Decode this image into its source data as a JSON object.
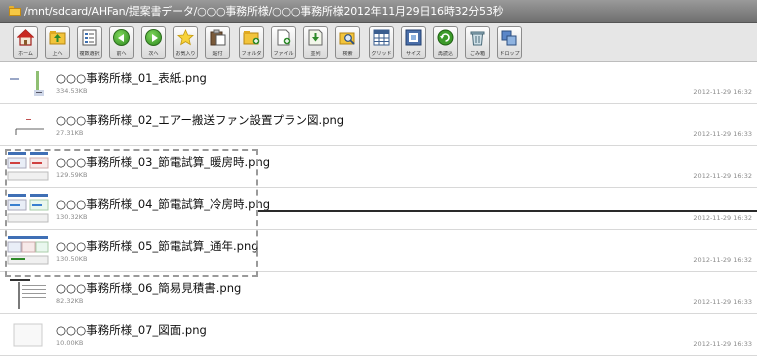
{
  "path": "/mnt/sdcard/AHFan/提案書データ/○○○事務所様/○○○事務所様2012年11月29日16時32分53秒",
  "toolbar": {
    "buttons": [
      {
        "label": "ホーム",
        "icon": "home-icon"
      },
      {
        "label": "上へ",
        "icon": "folder-up-icon"
      },
      {
        "label": "複数選択",
        "icon": "multi-select-icon"
      },
      {
        "label": "前へ",
        "icon": "back-arrow-icon"
      },
      {
        "label": "次へ",
        "icon": "forward-arrow-icon"
      },
      {
        "label": "お気入り",
        "icon": "star-icon"
      },
      {
        "label": "貼付",
        "icon": "paste-icon"
      },
      {
        "label": "フォルダ",
        "icon": "new-folder-icon"
      },
      {
        "label": "ファイル",
        "icon": "new-file-icon"
      },
      {
        "label": "並列",
        "icon": "sort-icon"
      },
      {
        "label": "検索",
        "icon": "search-icon"
      },
      {
        "label": "グリッド",
        "icon": "grid-icon"
      },
      {
        "label": "サイズ",
        "icon": "size-icon"
      },
      {
        "label": "再読込",
        "icon": "refresh-icon"
      },
      {
        "label": "ごみ箱",
        "icon": "trash-icon"
      },
      {
        "label": "ドロップ",
        "icon": "drop-icon"
      }
    ]
  },
  "files": [
    {
      "name": "○○○事務所様_01_表紙.png",
      "size": "334.53KB",
      "date": "2012-11-29 16:32"
    },
    {
      "name": "○○○事務所様_02_エアー搬送ファン設置プラン図.png",
      "size": "27.31KB",
      "date": "2012-11-29 16:33"
    },
    {
      "name": "○○○事務所様_03_節電試算_暖房時.png",
      "size": "129.59KB",
      "date": "2012-11-29 16:32"
    },
    {
      "name": "○○○事務所様_04_節電試算_冷房時.png",
      "size": "130.32KB",
      "date": "2012-11-29 16:32"
    },
    {
      "name": "○○○事務所様_05_節電試算_通年.png",
      "size": "130.50KB",
      "date": "2012-11-29 16:32"
    },
    {
      "name": "○○○事務所様_06_簡易見積書.png",
      "size": "82.32KB",
      "date": "2012-11-29 16:33"
    },
    {
      "name": "○○○事務所様_07_図面.png",
      "size": "10.00KB",
      "date": "2012-11-29 16:33"
    }
  ],
  "colors": {
    "pathbar": "#7f7f7f",
    "toolbar": "#e6e6e6",
    "selection": "#9a9a9a"
  }
}
